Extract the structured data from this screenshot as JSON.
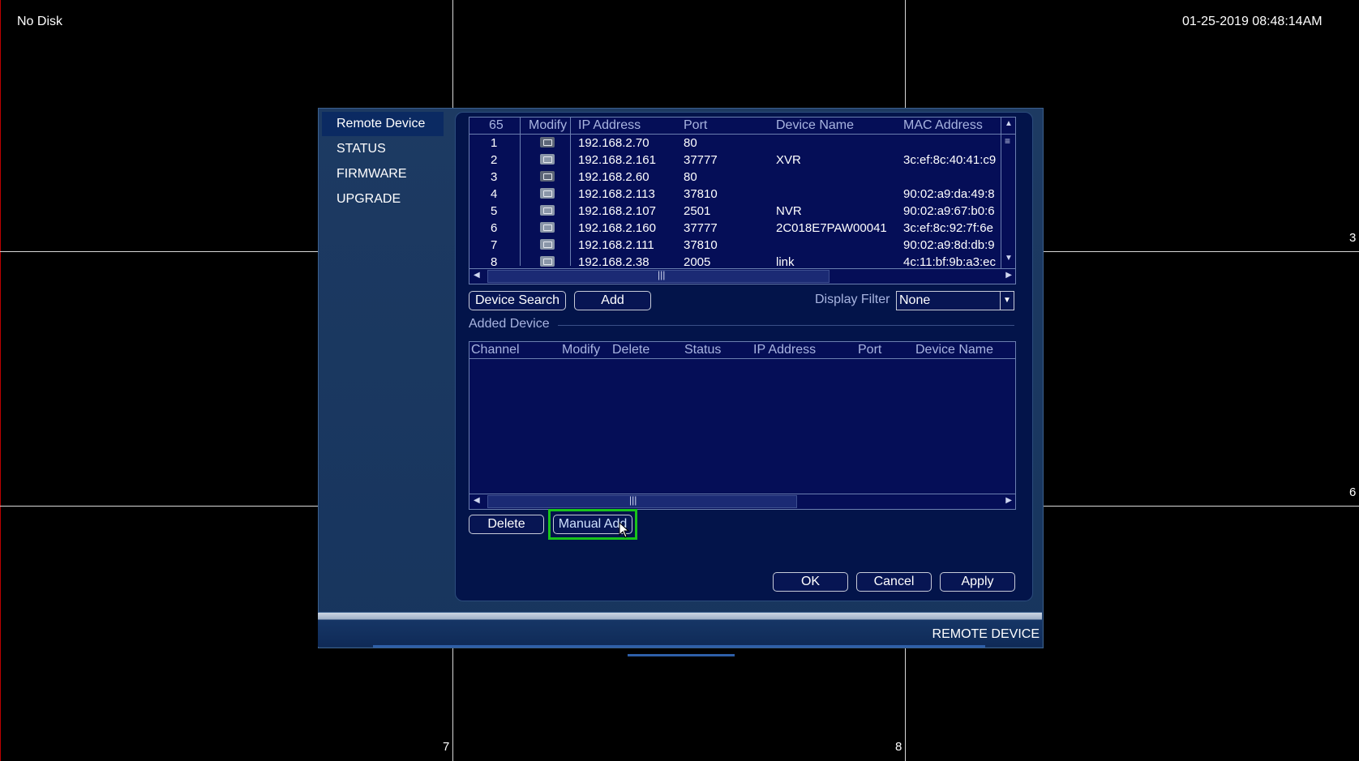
{
  "osd": {
    "disk_status": "No Disk",
    "datetime": "01-25-2019 08:48:14AM",
    "channel_labels": [
      "3",
      "6",
      "7",
      "8"
    ]
  },
  "sidebar": {
    "items": [
      {
        "label": "Remote Device",
        "active": true
      },
      {
        "label": "STATUS",
        "active": false
      },
      {
        "label": "FIRMWARE",
        "active": false
      },
      {
        "label": "UPGRADE",
        "active": false
      }
    ]
  },
  "search_table": {
    "count": "65",
    "headers": {
      "modify": "Modify",
      "ip": "IP Address",
      "port": "Port",
      "name": "Device Name",
      "mac": "MAC Address"
    },
    "rows": [
      {
        "no": "1",
        "ip": "192.168.2.70",
        "port": "80",
        "name": "",
        "mac": ""
      },
      {
        "no": "2",
        "ip": "192.168.2.161",
        "port": "37777",
        "name": "XVR",
        "mac": "3c:ef:8c:40:41:c9"
      },
      {
        "no": "3",
        "ip": "192.168.2.60",
        "port": "80",
        "name": "",
        "mac": ""
      },
      {
        "no": "4",
        "ip": "192.168.2.113",
        "port": "37810",
        "name": "",
        "mac": "90:02:a9:da:49:8"
      },
      {
        "no": "5",
        "ip": "192.168.2.107",
        "port": "2501",
        "name": "NVR",
        "mac": "90:02:a9:67:b0:6"
      },
      {
        "no": "6",
        "ip": "192.168.2.160",
        "port": "37777",
        "name": "2C018E7PAW00041",
        "mac": "3c:ef:8c:92:7f:6e"
      },
      {
        "no": "7",
        "ip": "192.168.2.111",
        "port": "37810",
        "name": "",
        "mac": "90:02:a9:8d:db:9"
      },
      {
        "no": "8",
        "ip": "192.168.2.38",
        "port": "2005",
        "name": "link",
        "mac": "4c:11:bf:9b:a3:ec"
      }
    ]
  },
  "search_controls": {
    "device_search": "Device Search",
    "add": "Add",
    "display_filter_label": "Display Filter",
    "display_filter_value": "None"
  },
  "added_device": {
    "section_label": "Added Device",
    "headers": {
      "channel": "Channel",
      "modify": "Modify",
      "delete": "Delete",
      "status": "Status",
      "ip": "IP Address",
      "port": "Port",
      "name": "Device Name"
    }
  },
  "added_controls": {
    "delete": "Delete",
    "manual_add": "Manual Add"
  },
  "dialog_buttons": {
    "ok": "OK",
    "cancel": "Cancel",
    "apply": "Apply"
  },
  "footer": {
    "title": "REMOTE DEVICE"
  },
  "colors": {
    "highlight": "#19c31b",
    "panel": "#03144a",
    "table_bg": "#050e57"
  }
}
